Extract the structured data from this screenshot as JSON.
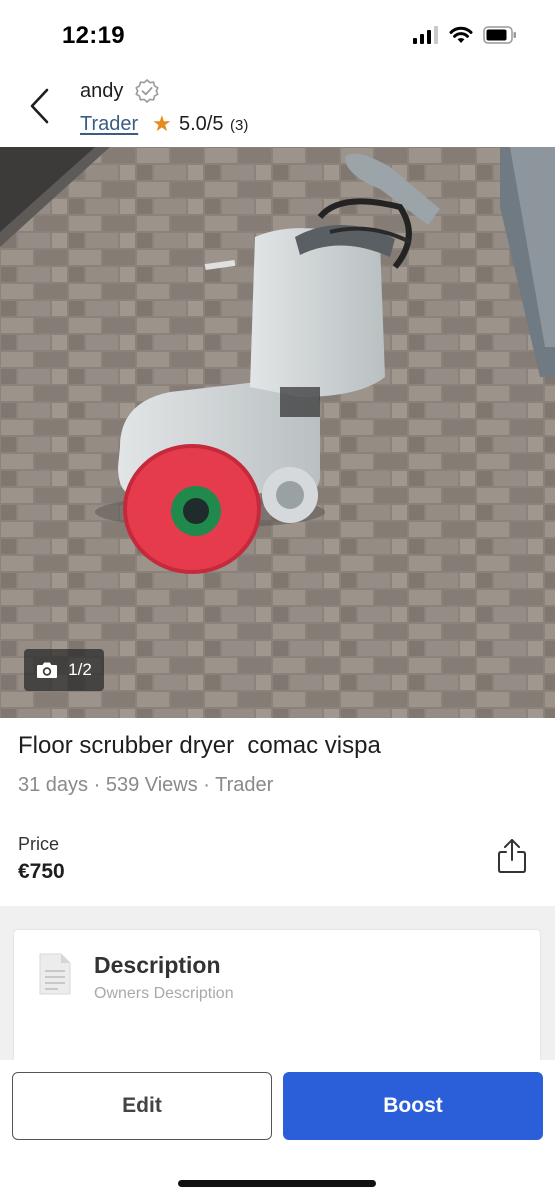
{
  "status_bar": {
    "time": "12:19"
  },
  "header": {
    "seller_name": "andy",
    "seller_type": "Trader",
    "rating": "5.0/5",
    "rating_count": "(3)"
  },
  "photo": {
    "counter": "1/2"
  },
  "listing": {
    "title": "Floor scrubber dryer  comac vispa",
    "meta": "31 days · 539 Views · Trader",
    "price_label": "Price",
    "price_value": "€750"
  },
  "description": {
    "title": "Description",
    "subtitle": "Owners Description"
  },
  "actions": {
    "edit_label": "Edit",
    "boost_label": "Boost"
  },
  "colors": {
    "accent": "#2b5fd9",
    "star": "#e68a1c",
    "link": "#3b5d84"
  }
}
